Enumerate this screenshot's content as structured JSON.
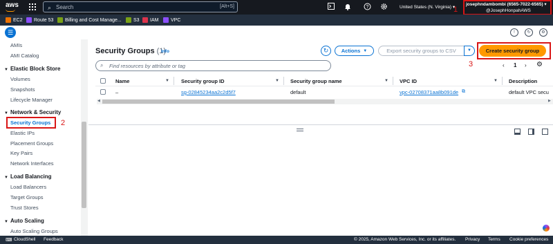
{
  "topnav": {
    "logo": "aws",
    "search_placeholder": "Search",
    "search_shortcut": "[Alt+S]",
    "region": "United States (N. Virginia) ▾",
    "account_name": "josephndambombi (6565-7022-6565) ▾",
    "account_user": "@JosephHonpahAWS",
    "annotation": "1",
    "icons": [
      "apps-icon",
      "cloudshell-icon",
      "bell-icon",
      "help-icon",
      "gear-icon"
    ]
  },
  "favorites": [
    {
      "label": "EC2",
      "color": "#ed7100"
    },
    {
      "label": "Route 53",
      "color": "#8c4fff"
    },
    {
      "label": "Billing and Cost Manage...",
      "color": "#7aa116"
    },
    {
      "label": "S3",
      "color": "#7aa116"
    },
    {
      "label": "IAM",
      "color": "#dd344c"
    },
    {
      "label": "VPC",
      "color": "#8c4fff"
    }
  ],
  "sidebar": {
    "top_links": [
      "AMIs",
      "AMI Catalog"
    ],
    "sections": [
      {
        "title": "Elastic Block Store",
        "items": [
          "Volumes",
          "Snapshots",
          "Lifecycle Manager"
        ]
      },
      {
        "title": "Network & Security",
        "items": [
          "Security Groups",
          "Elastic IPs",
          "Placement Groups",
          "Key Pairs",
          "Network Interfaces"
        ]
      },
      {
        "title": "Load Balancing",
        "items": [
          "Load Balancers",
          "Target Groups",
          "Trust Stores"
        ]
      },
      {
        "title": "Auto Scaling",
        "items": [
          "Auto Scaling Groups"
        ]
      }
    ],
    "annotation": "2"
  },
  "main": {
    "title": "Security Groups",
    "count": "(1)",
    "info": "Info",
    "actions_label": "Actions",
    "export_label": "Export security groups to CSV",
    "create_label": "Create security group",
    "annotation": "3",
    "find_placeholder": "Find resources by attribute or tag",
    "page": "1",
    "columns": [
      "Name",
      "Security group ID",
      "Security group name",
      "VPC ID",
      "Description"
    ],
    "rows": [
      {
        "name": "–",
        "sg_id": "sg-02845234aa2c2d5f7",
        "sg_name": "default",
        "vpc_id": "vpc-02708371aa8b091de",
        "description": "default VPC secu"
      }
    ]
  },
  "footer": {
    "cloudshell": "CloudShell",
    "feedback": "Feedback",
    "copyright": "© 2025, Amazon Web Services, Inc. or its affiliates.",
    "privacy": "Privacy",
    "terms": "Terms",
    "cookies": "Cookie preferences"
  },
  "colors": {
    "accent": "#0972d3",
    "primary_button": "#ff9900",
    "annotation": "#d91515",
    "nav_bg": "#16191f"
  }
}
